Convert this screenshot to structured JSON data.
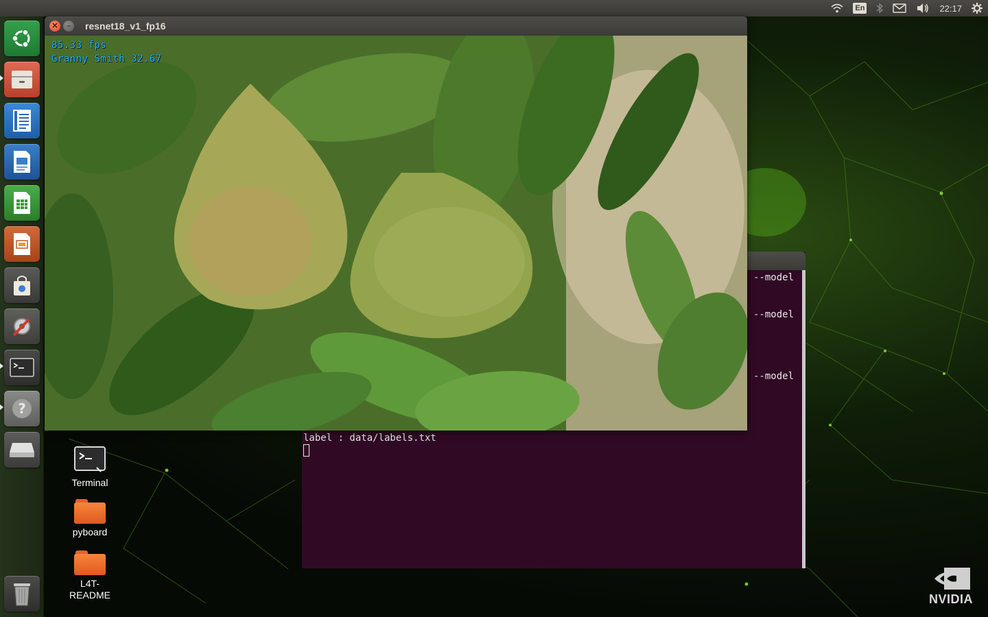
{
  "top_panel": {
    "keyboard_layout": "En",
    "clock": "22:17",
    "icons": [
      "wifi-icon",
      "bluetooth-icon",
      "mail-icon",
      "volume-icon",
      "settings-gear-icon"
    ]
  },
  "launcher": {
    "items": [
      {
        "name": "ubuntu-dash",
        "icon": "ubuntu-logo-icon"
      },
      {
        "name": "files",
        "icon": "file-cabinet-icon"
      },
      {
        "name": "text-editor",
        "icon": "text-document-icon"
      },
      {
        "name": "libreoffice-writer",
        "icon": "writer-document-icon"
      },
      {
        "name": "libreoffice-calc",
        "icon": "spreadsheet-icon"
      },
      {
        "name": "libreoffice-impress",
        "icon": "presentation-icon"
      },
      {
        "name": "software-center",
        "icon": "shopping-bag-icon"
      },
      {
        "name": "system-settings",
        "icon": "gear-wrench-icon"
      },
      {
        "name": "terminal",
        "icon": "terminal-icon"
      },
      {
        "name": "help",
        "icon": "question-mark-icon"
      },
      {
        "name": "drive",
        "icon": "disk-drive-icon"
      },
      {
        "name": "trash",
        "icon": "trash-icon"
      }
    ]
  },
  "video_window": {
    "title": "resnet18_v1_fp16",
    "fps_text": "85.33 fps",
    "classification_text": "Granny Smith 32.67"
  },
  "terminal_window": {
    "side_lines": [
      "--model",
      "--model",
      "--model"
    ],
    "label_line": "label : data/labels.txt"
  },
  "desktop_icons": [
    {
      "label": "Terminal",
      "icon": "terminal-shortcut-icon"
    },
    {
      "label": "pyboard",
      "icon": "folder-icon"
    },
    {
      "label": "L4T-\nREADME",
      "icon": "folder-icon"
    }
  ],
  "wallpaper": {
    "brand": "NVIDIA",
    "accent_color": "#76b900"
  },
  "colors": {
    "terminal_bg": "#300a24",
    "overlay_text": "#29b6ff",
    "panel_bg": "#3c3b37"
  }
}
